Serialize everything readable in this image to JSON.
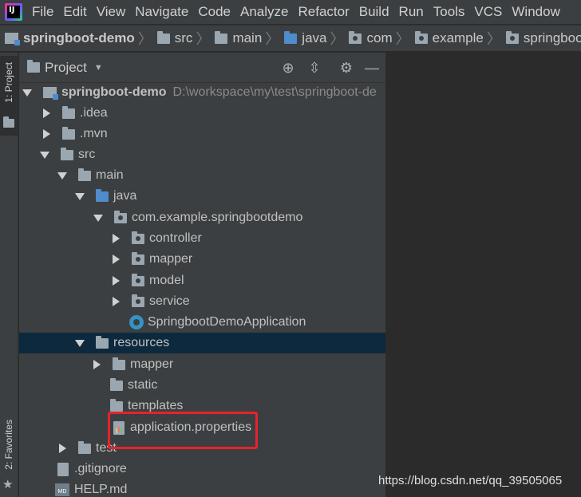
{
  "menubar": {
    "items": [
      "File",
      "Edit",
      "View",
      "Navigate",
      "Code",
      "Analyze",
      "Refactor",
      "Build",
      "Run",
      "Tools",
      "VCS",
      "Window"
    ]
  },
  "breadcrumb": [
    "springboot-demo",
    "src",
    "main",
    "java",
    "com",
    "example",
    "springbootdemo"
  ],
  "stripe": {
    "project_label": "1: Project",
    "favorites_label": "2: Favorites"
  },
  "panel": {
    "title": "Project"
  },
  "tree": {
    "root": {
      "label": "springboot-demo",
      "path": "D:\\workspace\\my\\test\\springboot-de"
    },
    "idea": ".idea",
    "mvn": ".mvn",
    "src": "src",
    "main": "main",
    "java": "java",
    "package": "com.example.springbootdemo",
    "controller": "controller",
    "mapper": "mapper",
    "model": "model",
    "service": "service",
    "app_class": "SpringbootDemoApplication",
    "resources": "resources",
    "res_mapper": "mapper",
    "static": "static",
    "templates": "templates",
    "app_props": "application.properties",
    "test": "test",
    "gitignore": ".gitignore",
    "help": "HELP.md"
  },
  "watermark": "https://blog.csdn.net/qq_39505065",
  "colors": {
    "background": "#2b2b2b",
    "panel": "#3c3f41",
    "selection": "#0d293e",
    "highlight_box": "#e8222b",
    "folder_blue": "#4f8ccc"
  }
}
